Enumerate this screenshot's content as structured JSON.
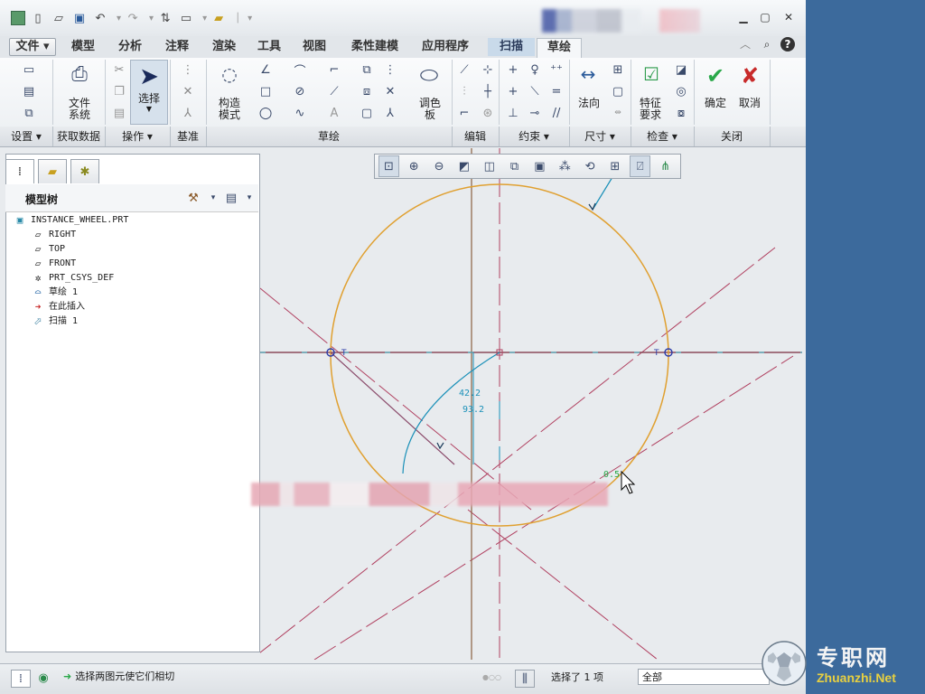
{
  "titlebar": {
    "quick_access": [
      "app-icon",
      "new-icon",
      "open-icon",
      "save-icon",
      "undo-icon",
      "redo-icon",
      "regenerate-icon",
      "window-icon",
      "folder-icon"
    ]
  },
  "tabs": {
    "file": "文件",
    "items": [
      "模型",
      "分析",
      "注释",
      "渲染",
      "工具",
      "视图",
      "柔性建模",
      "应用程序"
    ],
    "scan": "扫描",
    "sketch": "草绘"
  },
  "ribbon": {
    "file_system": "文件\n系统",
    "select": "选择",
    "construct_mode": "构造\n模式",
    "palette": "调色\n板",
    "normal": "法向",
    "feature_req": "特征\n要求",
    "ok": "确定",
    "cancel": "取消"
  },
  "groups": {
    "settings": "设置",
    "get_data": "获取数据",
    "operations": "操作",
    "datum": "基准",
    "sketch": "草绘",
    "edit": "编辑",
    "constraints": "约束",
    "dimension": "尺寸",
    "inspect": "检查",
    "close": "关闭"
  },
  "model_tree": {
    "title": "模型树",
    "items": [
      {
        "label": "INSTANCE_WHEEL.PRT",
        "icon": "part-icon"
      },
      {
        "label": "RIGHT",
        "icon": "plane-icon"
      },
      {
        "label": "TOP",
        "icon": "plane-icon"
      },
      {
        "label": "FRONT",
        "icon": "plane-icon"
      },
      {
        "label": "PRT_CSYS_DEF",
        "icon": "csys-icon"
      },
      {
        "label": "草绘 1",
        "icon": "sketch-icon"
      },
      {
        "label": "在此插入",
        "icon": "insert-arrow-icon"
      },
      {
        "label": "扫描 1",
        "icon": "sweep-icon"
      }
    ]
  },
  "canvas": {
    "dim1": "42.2",
    "dim2": "93.2",
    "dim3": "0.5"
  },
  "status": {
    "message": "选择两图元使它们相切",
    "selected": "选择了 1 项",
    "filter": "全部"
  },
  "watermark": {
    "cn": "专职网",
    "en": "Zhuanzhi.Net"
  },
  "colors": {
    "circle": "#e0a030",
    "centerline": "#b04060",
    "dimension": "#1a90b8",
    "axis_h": "#703040"
  }
}
